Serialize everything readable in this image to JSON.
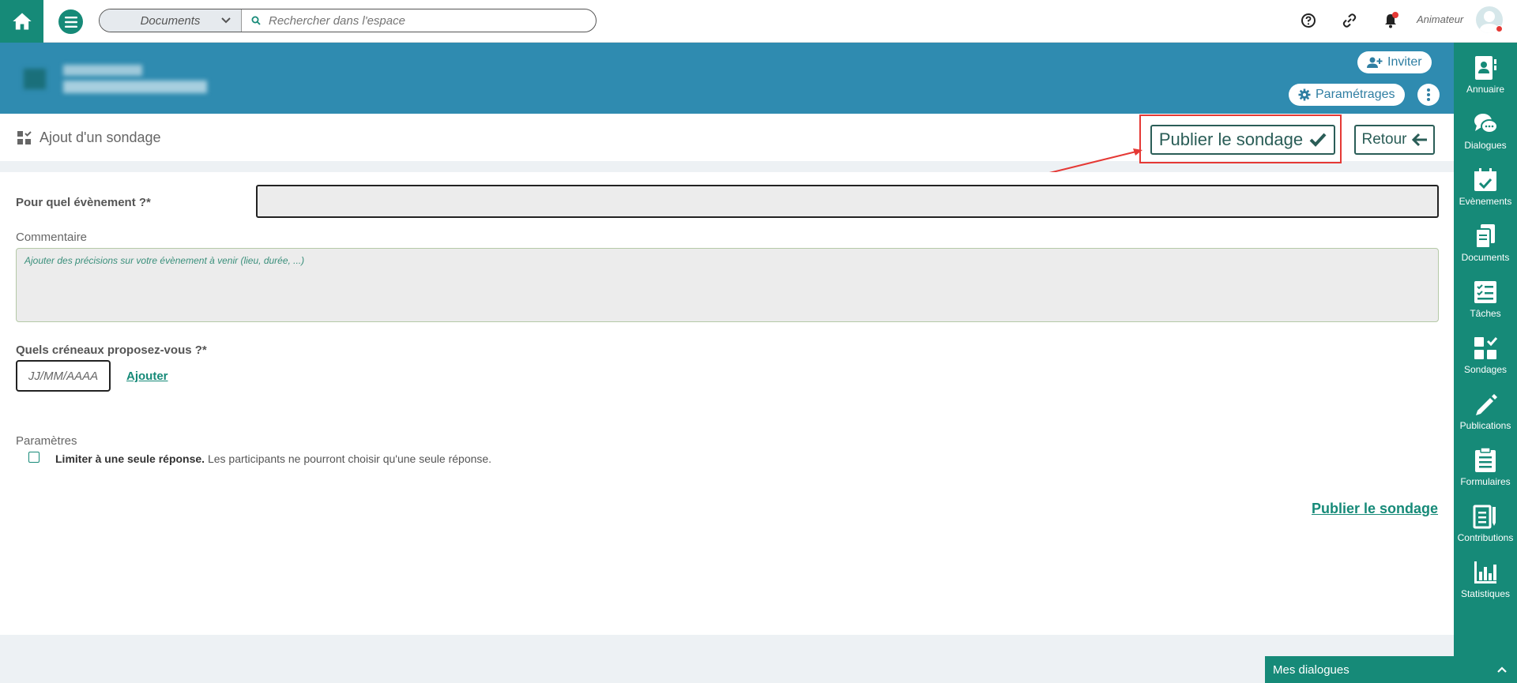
{
  "topbar": {
    "search_scope": "Documents",
    "search_placeholder": "Rechercher dans l'espace",
    "role_label": "Animateur"
  },
  "banner": {
    "invite_label": "Inviter",
    "settings_label": "Paramétrages"
  },
  "page": {
    "title": "Ajout d'un sondage",
    "publish_button": "Publier le sondage",
    "back_button": "Retour"
  },
  "form": {
    "event_label": "Pour quel évènement ?*",
    "comment_label": "Commentaire",
    "comment_placeholder": "Ajouter des précisions sur votre évènement à venir (lieu, durée, ...)",
    "slots_label": "Quels créneaux proposez-vous ?*",
    "date_placeholder": "JJ/MM/AAAA",
    "add_link": "Ajouter",
    "params_label": "Paramètres",
    "limit_bold": "Limiter à une seule réponse.",
    "limit_text": " Les participants ne pourront choisir qu'une seule réponse.",
    "publish_link": "Publier le sondage"
  },
  "sidebar": {
    "items": [
      {
        "label": "Annuaire",
        "icon": "directory-icon"
      },
      {
        "label": "Dialogues",
        "icon": "chat-icon"
      },
      {
        "label": "Evènements",
        "icon": "calendar-icon"
      },
      {
        "label": "Documents",
        "icon": "documents-icon"
      },
      {
        "label": "Tâches",
        "icon": "tasks-icon"
      },
      {
        "label": "Sondages",
        "icon": "poll-icon"
      },
      {
        "label": "Publications",
        "icon": "pencil-icon"
      },
      {
        "label": "Formulaires",
        "icon": "form-icon"
      },
      {
        "label": "Contributions",
        "icon": "contributions-icon"
      },
      {
        "label": "Statistiques",
        "icon": "chart-icon"
      }
    ]
  },
  "dialogs": {
    "label": "Mes dialogues"
  },
  "colors": {
    "primary": "#168a78",
    "banner": "#2f8bb0",
    "annotation": "#e53935"
  }
}
